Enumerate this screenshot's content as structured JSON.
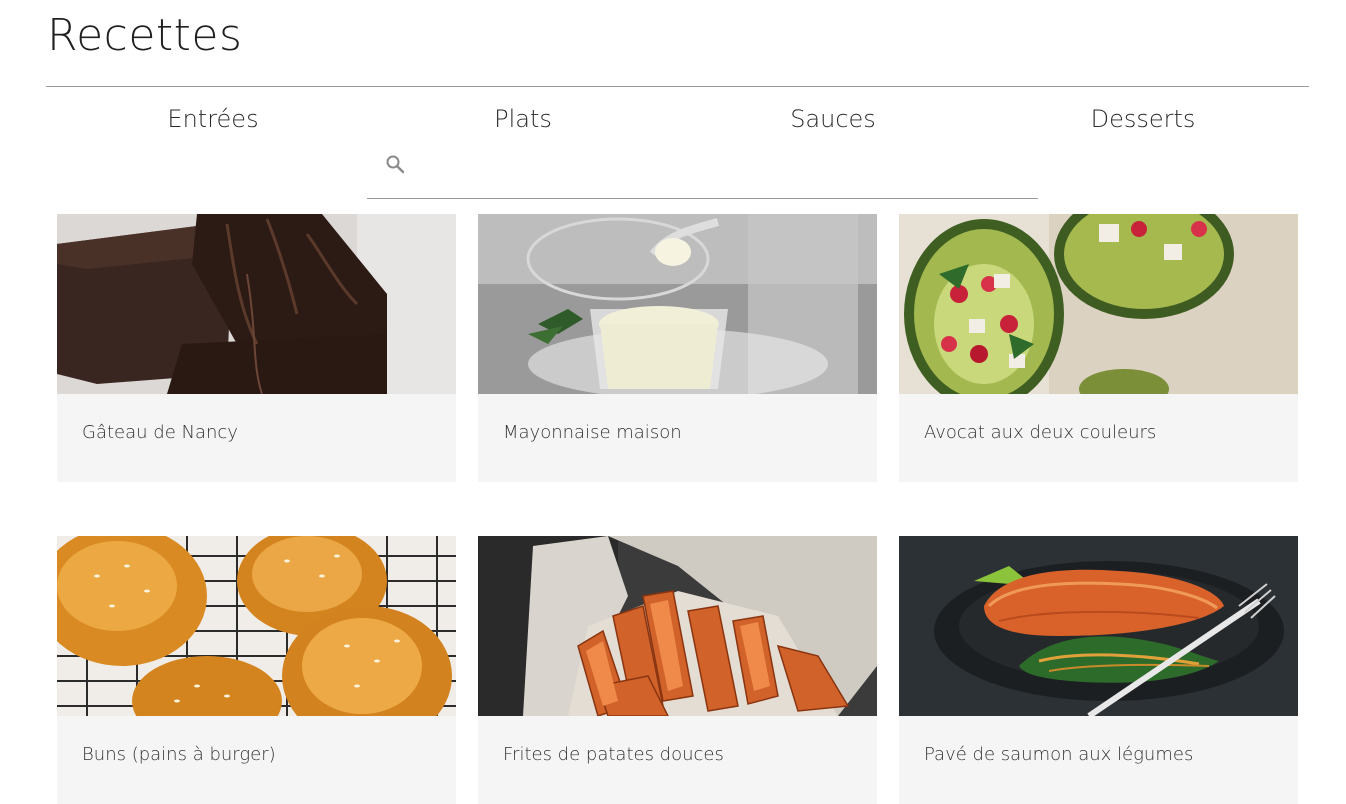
{
  "page": {
    "title": "Recettes"
  },
  "nav": {
    "items": [
      {
        "label": "Entrées"
      },
      {
        "label": "Plats"
      },
      {
        "label": "Sauces"
      },
      {
        "label": "Desserts"
      }
    ]
  },
  "search": {
    "icon": "search-icon",
    "value": "",
    "placeholder": ""
  },
  "recipes": [
    {
      "title": "Gâteau de Nancy",
      "image": "chocolate-cake-photo"
    },
    {
      "title": "Mayonnaise maison",
      "image": "mayonnaise-bowl-photo"
    },
    {
      "title": "Avocat aux deux couleurs",
      "image": "stuffed-avocado-photo"
    },
    {
      "title": "Buns (pains à burger)",
      "image": "burger-buns-photo"
    },
    {
      "title": "Frites de patates douces",
      "image": "sweet-potato-fries-photo"
    },
    {
      "title": "Pavé de saumon aux légumes",
      "image": "salmon-vegetables-photo"
    }
  ],
  "colors": {
    "card_background": "#f5f5f5",
    "divider": "#9a9a9a",
    "text": "#222222"
  }
}
